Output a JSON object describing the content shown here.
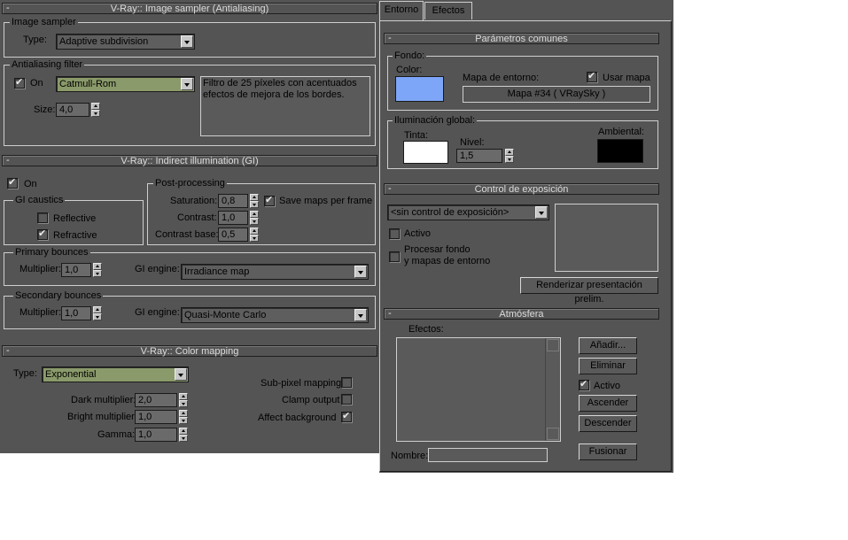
{
  "image_sampler": {
    "header": "V-Ray:: Image sampler (Antialiasing)",
    "group_title": "Image sampler",
    "type_label": "Type:",
    "type_value": "Adaptive subdivision",
    "aa_group_title": "Antialiasing filter",
    "on_label": "On",
    "filter_value": "Catmull-Rom",
    "size_label": "Size:",
    "size_value": "4,0",
    "description": "Filtro de 25 píxeles con acentuados efectos de mejora de los bordes."
  },
  "gi": {
    "header": "V-Ray:: Indirect illumination (GI)",
    "on_label": "On",
    "caustics_title": "GI caustics",
    "reflective_label": "Reflective",
    "refractive_label": "Refractive",
    "post_title": "Post-processing",
    "saturation_label": "Saturation:",
    "saturation_value": "0,8",
    "save_maps_label": "Save maps per frame",
    "contrast_label": "Contrast:",
    "contrast_value": "1,0",
    "contrast_base_label": "Contrast base:",
    "contrast_base_value": "0,5",
    "primary_title": "Primary bounces",
    "primary_multiplier_label": "Multiplier:",
    "primary_multiplier_value": "1,0",
    "primary_engine_label": "GI engine:",
    "primary_engine_value": "Irradiance map",
    "secondary_title": "Secondary bounces",
    "secondary_multiplier_label": "Multiplier:",
    "secondary_multiplier_value": "1,0",
    "secondary_engine_label": "GI engine:",
    "secondary_engine_value": "Quasi-Monte Carlo"
  },
  "color_mapping": {
    "header": "V-Ray:: Color mapping",
    "type_label": "Type:",
    "type_value": "Exponential",
    "dark_label": "Dark multiplier:",
    "dark_value": "2,0",
    "bright_label": "Bright multiplier:",
    "bright_value": "1,0",
    "gamma_label": "Gamma:",
    "gamma_value": "1,0",
    "subpixel_label": "Sub-pixel mapping",
    "clamp_label": "Clamp output",
    "affect_bg_label": "Affect background"
  },
  "environment": {
    "tabs": [
      "Entorno",
      "Efectos"
    ],
    "common_header": "Parámetros comunes",
    "fondo_title": "Fondo:",
    "color_label": "Color:",
    "bg_color": "#7ea6f8",
    "env_map_label": "Mapa de entorno:",
    "use_map_label": "Usar mapa",
    "map_button": "Mapa #34  ( VRaySky )",
    "global_illum_title": "Iluminación global:",
    "tint_label": "Tinta:",
    "tint_color": "#ffffff",
    "level_label": "Nivel:",
    "level_value": "1,5",
    "ambient_label": "Ambiental:",
    "ambient_color": "#000000",
    "exposure_header": "Control de exposición",
    "exposure_value": "<sin control de exposición>",
    "active_label": "Activo",
    "process_bg_label_1": "Procesar fondo",
    "process_bg_label_2": "y mapas de entorno",
    "render_preview_button": "Renderizar presentación prelim.",
    "atmosphere_header": "Atmósfera",
    "effects_label": "Efectos:",
    "add_button": "Añadir...",
    "delete_button": "Eliminar",
    "atm_active_label": "Activo",
    "up_button": "Ascender",
    "down_button": "Descender",
    "name_label": "Nombre:",
    "merge_button": "Fusionar"
  }
}
